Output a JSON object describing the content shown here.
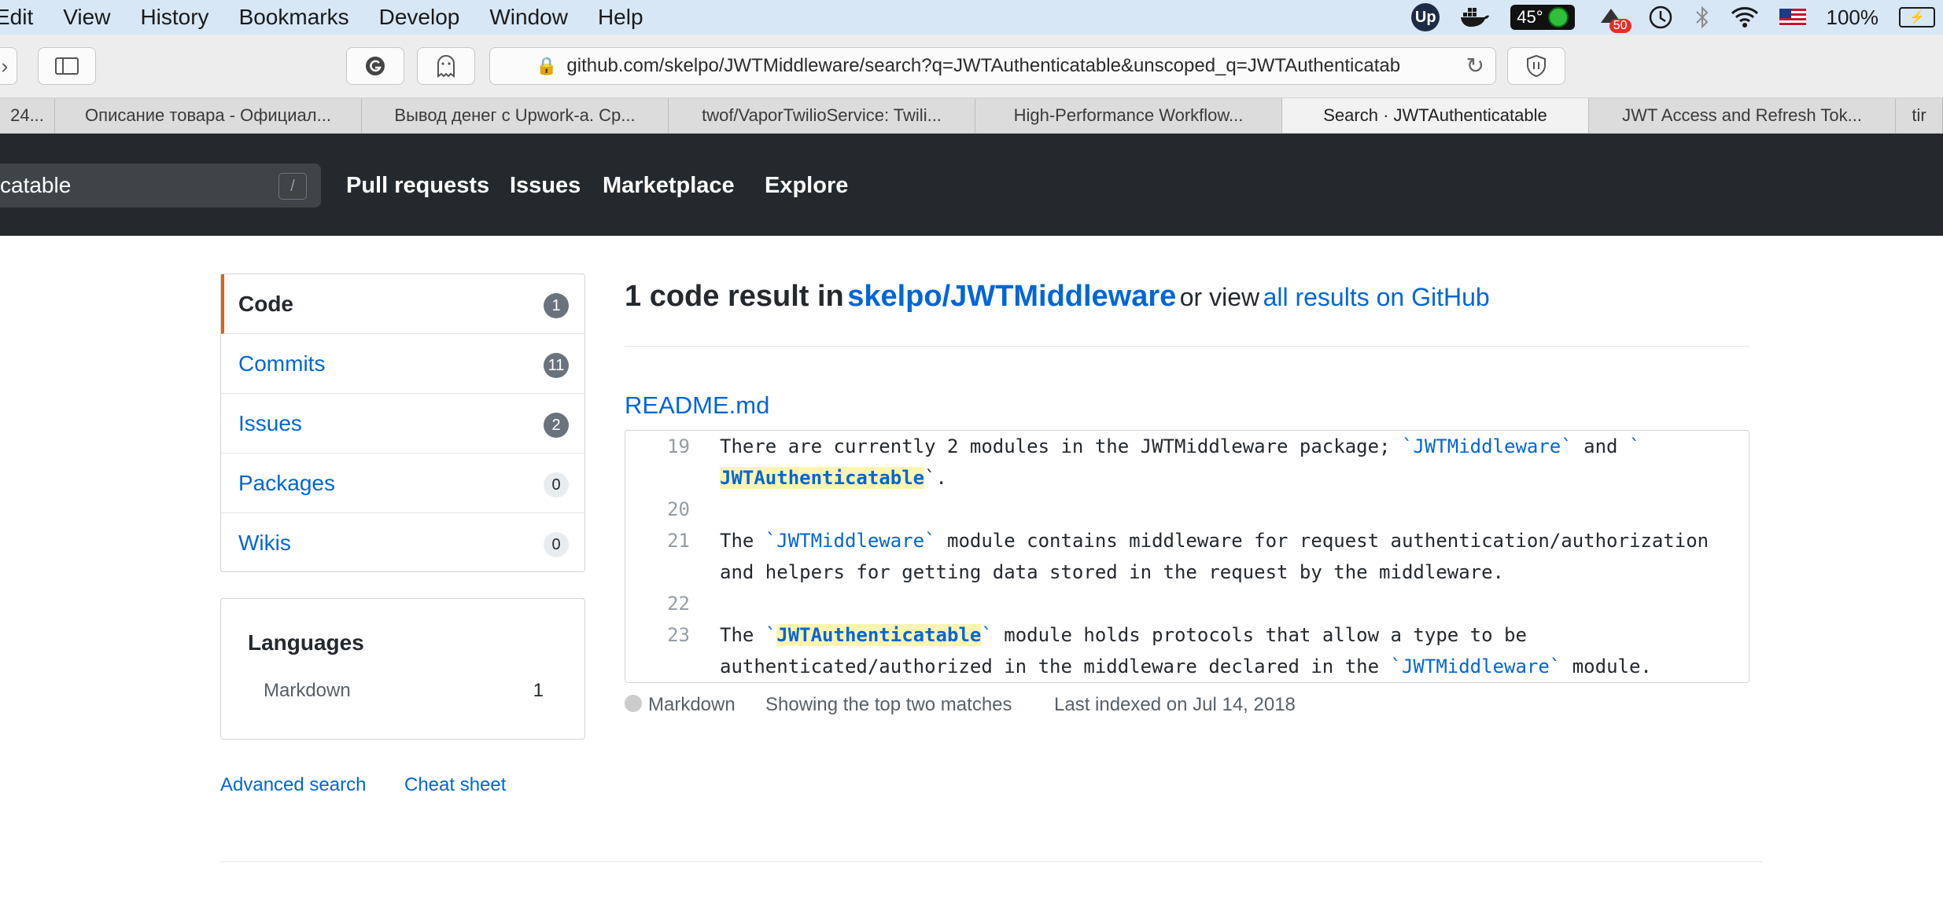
{
  "menubar": {
    "items": [
      "Edit",
      "View",
      "History",
      "Bookmarks",
      "Develop",
      "Window",
      "Help"
    ],
    "upwork_icon": "Up",
    "temperature": "45°",
    "badge_count": "50",
    "battery": "100%"
  },
  "toolbar": {
    "url": "github.com/skelpo/JWTMiddleware/search?q=JWTAuthenticatable&unscoped_q=JWTAuthenticatab"
  },
  "tabs": [
    {
      "label": "24..."
    },
    {
      "label": "Описание товара - Официал..."
    },
    {
      "label": "Вывод денег с Upwork-а. Ср..."
    },
    {
      "label": "twof/VaporTwilioService: Twili..."
    },
    {
      "label": "High-Performance Workflow..."
    },
    {
      "label": "Search · JWTAuthenticatable"
    },
    {
      "label": "JWT Access and Refresh Tok..."
    },
    {
      "label": "tir"
    }
  ],
  "header": {
    "search_value": "catable",
    "search_shortcut": "/",
    "nav": [
      "Pull requests",
      "Issues",
      "Marketplace",
      "Explore"
    ]
  },
  "sidebar": {
    "filters": [
      {
        "label": "Code",
        "count": "1"
      },
      {
        "label": "Commits",
        "count": "11"
      },
      {
        "label": "Issues",
        "count": "2"
      },
      {
        "label": "Packages",
        "count": "0"
      },
      {
        "label": "Wikis",
        "count": "0"
      }
    ],
    "languages_title": "Languages",
    "language": {
      "name": "Markdown",
      "count": "1"
    },
    "advanced_search": "Advanced search",
    "cheat_sheet": "Cheat sheet"
  },
  "results": {
    "count_text": "1 code result in",
    "repo": "skelpo/JWTMiddleware",
    "or_view": "or view",
    "all_results": "all results on GitHub",
    "file": "README.md",
    "lines": {
      "n19": "19",
      "n20": "20",
      "n21": "21",
      "n22": "22",
      "n23": "23",
      "l19a": "There are currently 2 modules in the JWTMiddleware package; ",
      "l19b": "`JWTMiddleware`",
      "l19c": " and ",
      "l19d": "`",
      "l19e": "JWTAuthenticatable",
      "l19f": "`.",
      "l21a": "The ",
      "l21b": "`JWTMiddleware`",
      "l21c": " module contains middleware for request authentication/authorization",
      "l21d": "and helpers for getting data stored in the request by the middleware.",
      "l23a": "The ",
      "l23b": "`",
      "l23c": "JWTAuthenticatable",
      "l23d": "`",
      "l23e": " module holds protocols that allow a type to be",
      "l23f": "authenticated/authorized in the middleware declared in the ",
      "l23g": "`JWTMiddleware`",
      "l23h": " module."
    },
    "meta_language": "Markdown",
    "meta_matches": "Showing the top two matches",
    "meta_indexed": "Last indexed on Jul 14, 2018"
  },
  "colors": {
    "header_bg": "#24292e",
    "link": "#0366d6",
    "selected_accent": "#e36209",
    "highlight": "#fff5b1"
  }
}
